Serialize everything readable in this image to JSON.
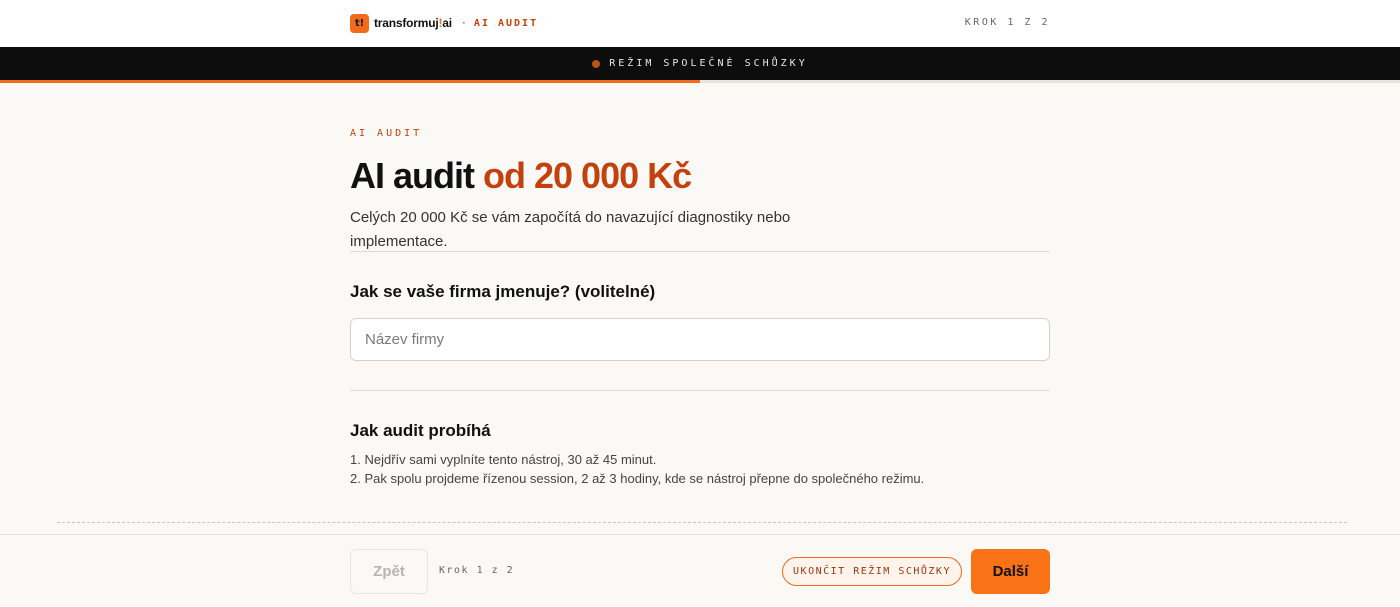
{
  "header": {
    "logo_mark": "t!",
    "logo_text_before": "transformuj",
    "logo_text_bang": "!",
    "logo_text_after": "ai",
    "separator": "·",
    "section": "AI AUDIT",
    "step": "KROK 1 Z 2"
  },
  "mode_bar": {
    "label": "REŽIM SPOLEČNÉ SCHŮZKY"
  },
  "progress": {
    "fraction": 0.5,
    "color": "#f26a1b"
  },
  "intro": {
    "eyebrow": "AI AUDIT",
    "headline_main": "AI audit",
    "headline_accent": "od 20 000 Kč",
    "subtitle": "Celých 20 000 Kč se vám započítá do navazující diagnostiky nebo implementace."
  },
  "company": {
    "question": "Jak se vaše firma jmenuje? (volitelné)",
    "placeholder": "Název firmy",
    "value": ""
  },
  "how": {
    "title": "Jak audit probíhá",
    "steps": [
      "1. Nejdřív sami vyplníte tento nástroj, 30 až 45 minut.",
      "2. Pak spolu projdeme řízenou session, 2 až 3 hodiny, kde se nástroj přepne do společného režimu."
    ]
  },
  "footer": {
    "back_label": "Zpět",
    "step": "Krok 1 z 2",
    "end_mode_label": "UKONČIT REŽIM SCHŮZKY",
    "next_label": "Další"
  },
  "colors": {
    "accent": "#c2410c",
    "brand_orange": "#f97316",
    "dark_bar": "#0d0d0d",
    "background": "#faf9f6"
  },
  "icons": {
    "logo": "brand-logo-icon",
    "mode_indicator": "recording-dot-icon"
  }
}
